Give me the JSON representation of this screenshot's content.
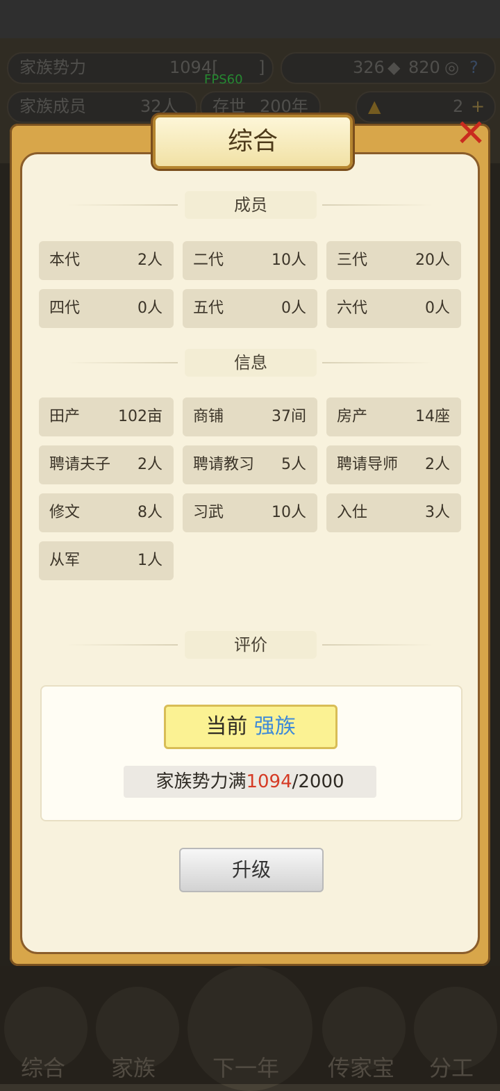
{
  "status_fps": "FPS60",
  "hud": {
    "power_label": "家族势力",
    "power_value": "1094[",
    "power_bracket_end": "]",
    "currency_a": "326",
    "currency_b": "820",
    "members_label": "家族成员",
    "members_value": "32人",
    "alive_label": "存世",
    "alive_value": "200年",
    "gold_value": "2",
    "help_icon": "question-mark",
    "add_icon": "plus"
  },
  "modal": {
    "title": "综合",
    "close_icon": "close-x",
    "members_section": "成员",
    "members": [
      {
        "label": "本代",
        "value": "2人"
      },
      {
        "label": "二代",
        "value": "10人"
      },
      {
        "label": "三代",
        "value": "20人"
      },
      {
        "label": "四代",
        "value": "0人"
      },
      {
        "label": "五代",
        "value": "0人"
      },
      {
        "label": "六代",
        "value": "0人"
      }
    ],
    "info_section": "信息",
    "info": [
      {
        "label": "田产",
        "value": "102亩"
      },
      {
        "label": "商铺",
        "value": "37间"
      },
      {
        "label": "房产",
        "value": "14座"
      },
      {
        "label": "聘请夫子",
        "value": "2人"
      },
      {
        "label": "聘请教习",
        "value": "5人"
      },
      {
        "label": "聘请导师",
        "value": "2人"
      },
      {
        "label": "修文",
        "value": "8人"
      },
      {
        "label": "习武",
        "value": "10人"
      },
      {
        "label": "入仕",
        "value": "3人"
      },
      {
        "label": "从军",
        "value": "1人"
      }
    ],
    "eval_section": "评价",
    "rank_prefix": "当前",
    "rank_name": "强族",
    "progress_prefix": "家族势力满",
    "progress_current": "1094",
    "progress_sep_total": "/2000",
    "upgrade_label": "升级"
  },
  "bottom_nav": [
    "综合",
    "家族",
    "下一年",
    "传家宝",
    "分工"
  ]
}
